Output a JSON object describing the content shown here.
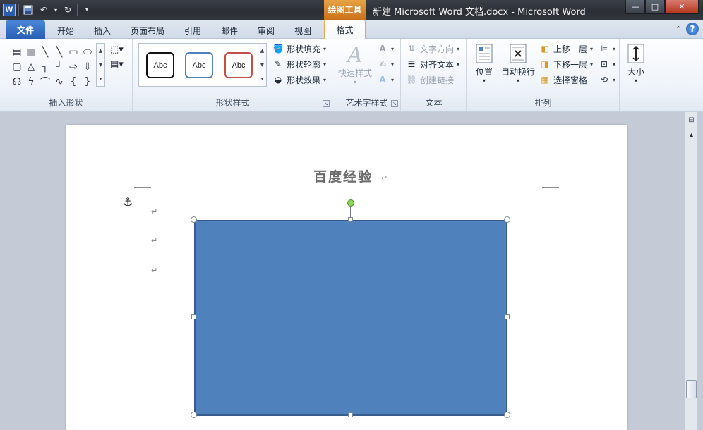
{
  "window": {
    "app_icon": "W",
    "title": "新建 Microsoft Word 文档.docx  -  Microsoft Word",
    "context_tab_header": "绘图工具",
    "controls": {
      "minimize": "—",
      "maximize": "□",
      "close": "✕"
    }
  },
  "tabs": [
    {
      "label": "文件"
    },
    {
      "label": "开始"
    },
    {
      "label": "插入"
    },
    {
      "label": "页面布局"
    },
    {
      "label": "引用"
    },
    {
      "label": "邮件"
    },
    {
      "label": "审阅"
    },
    {
      "label": "视图"
    },
    {
      "label": "格式"
    }
  ],
  "active_tab": "格式",
  "help": "?",
  "groups": {
    "insert_shapes": {
      "label": "插入形状"
    },
    "shape_styles": {
      "label": "形状样式",
      "gallery": [
        {
          "text": "Abc",
          "border": "#111111"
        },
        {
          "text": "Abc",
          "border": "#4f81bd"
        },
        {
          "text": "Abc",
          "border": "#c0504d"
        }
      ],
      "fill": "形状填充",
      "outline": "形状轮廓",
      "effects": "形状效果"
    },
    "wordart": {
      "label": "艺术字样式",
      "quick_styles": "快速样式"
    },
    "text": {
      "label": "文本",
      "direction": "文字方向",
      "align": "对齐文本",
      "link": "创建链接"
    },
    "arrange": {
      "label": "排列",
      "position": "位置",
      "wrap": "自动换行",
      "forward": "上移一层",
      "backward": "下移一层",
      "selection_pane": "选择窗格"
    },
    "size": {
      "label": "大小"
    }
  },
  "document": {
    "title": "百度经验",
    "pilcrow": "↵",
    "anchor": "⚓"
  },
  "colors": {
    "shape_fill": "#4f81bd",
    "shape_border": "#385d8a",
    "context_tab": "#e08a2e",
    "file_tab": "#2a5fb3"
  }
}
